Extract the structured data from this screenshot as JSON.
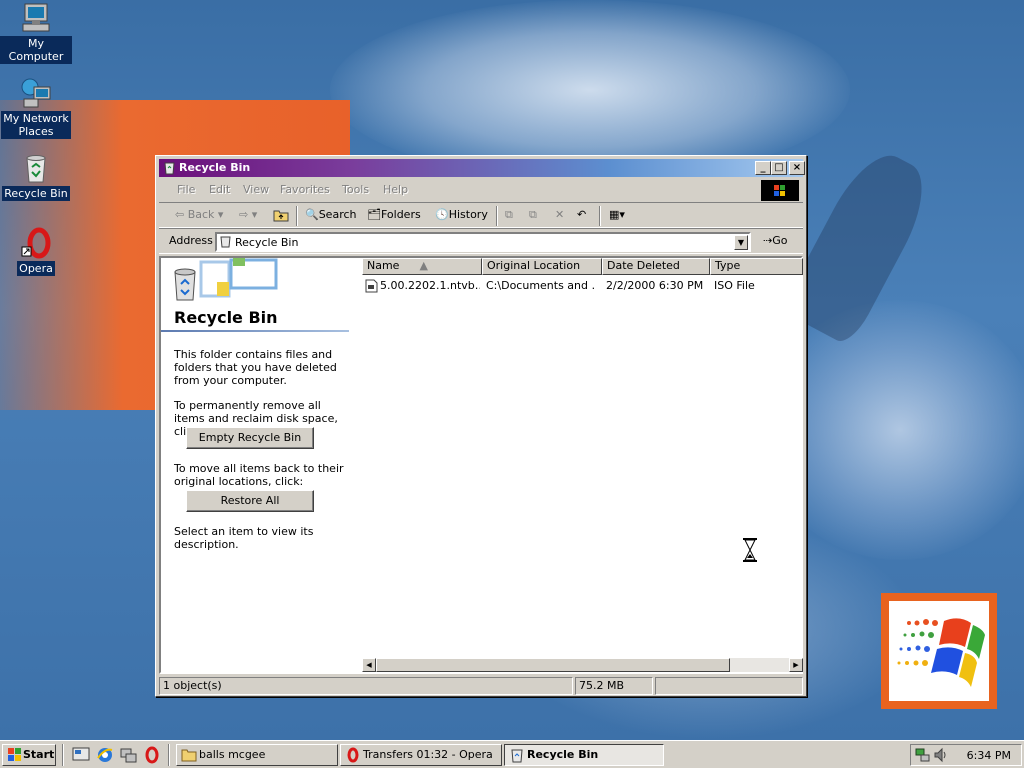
{
  "desktop": {
    "icons": [
      {
        "label": "My Computer",
        "icon": "computer-icon"
      },
      {
        "label": "My Network\nPlaces",
        "icon": "network-icon"
      },
      {
        "label": "Recycle Bin",
        "icon": "recycle-bin-icon"
      },
      {
        "label": "Opera",
        "icon": "opera-icon"
      }
    ]
  },
  "window": {
    "title": "Recycle Bin",
    "menu": [
      "File",
      "Edit",
      "View",
      "Favorites",
      "Tools",
      "Help"
    ],
    "toolbar": {
      "back": "Back",
      "search": "Search",
      "folders": "Folders",
      "history": "History"
    },
    "address": {
      "label": "Address",
      "value": "Recycle Bin",
      "go": "Go"
    },
    "left_pane": {
      "title": "Recycle Bin",
      "intro": "This folder contains files and folders that you have deleted from your computer.",
      "remove_text": "To permanently remove all items and reclaim disk space, click:",
      "empty_button": "Empty Recycle Bin",
      "restore_text": "To move all items back to their original locations, click:",
      "restore_button": "Restore All",
      "select_text": "Select an item to view its description."
    },
    "columns": [
      "Name",
      "Original Location",
      "Date Deleted",
      "Type"
    ],
    "rows": [
      {
        "name": "5.00.2202.1.ntvb…",
        "location": "C:\\Documents and …",
        "date": "2/2/2000 6:30 PM",
        "type": "ISO File"
      }
    ],
    "status": {
      "objects": "1 object(s)",
      "size": "75.2 MB"
    }
  },
  "taskbar": {
    "start": "Start",
    "tasks": [
      {
        "label": "balls mcgee",
        "active": false
      },
      {
        "label": "Transfers 01:32 - Opera",
        "active": false
      },
      {
        "label": "Recycle Bin",
        "active": true
      }
    ],
    "clock": "6:34 PM"
  },
  "colors": {
    "desktop": "#3a6ea5",
    "accent_orange": "#e8631f",
    "title_gradient_start": "#6b0f7a",
    "title_gradient_end": "#a6caf0"
  }
}
